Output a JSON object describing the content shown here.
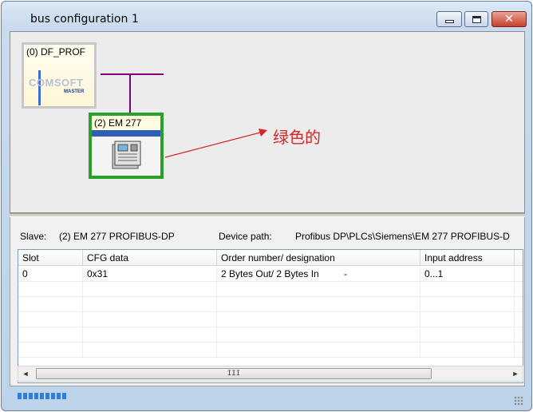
{
  "window": {
    "title": "bus configuration 1"
  },
  "controls": {
    "minimize_icon": "minimize-icon",
    "maximize_icon": "maximize-icon",
    "close_glyph": "✕"
  },
  "canvas": {
    "master": {
      "label": "(0) DF_PROF",
      "logo_text": "COMSOFT",
      "logo_sub": "MASTER"
    },
    "slave": {
      "label": "(2) EM 277",
      "border_color": "#2aa12a",
      "selected": true
    },
    "bus_color": "#800080",
    "annotation": {
      "text": "绿色的",
      "color": "#d62626"
    }
  },
  "info": {
    "slave_label": "Slave:",
    "slave_value": "(2) EM 277 PROFIBUS-DP",
    "path_label": "Device path:",
    "path_value": "Profibus DP\\PLCs\\Siemens\\EM 277 PROFIBUS-D"
  },
  "table": {
    "columns": [
      "Slot",
      "CFG data",
      "Order number/ designation",
      "Input address"
    ],
    "rows": [
      [
        "0",
        "0x31",
        "2 Bytes Out/ 2 Bytes In",
        "-",
        "0...1"
      ]
    ]
  },
  "scrollbar": {
    "left_arrow": "◄",
    "right_arrow": "►",
    "thumb_grip": "III"
  },
  "status": {
    "progress_segments": 9
  }
}
